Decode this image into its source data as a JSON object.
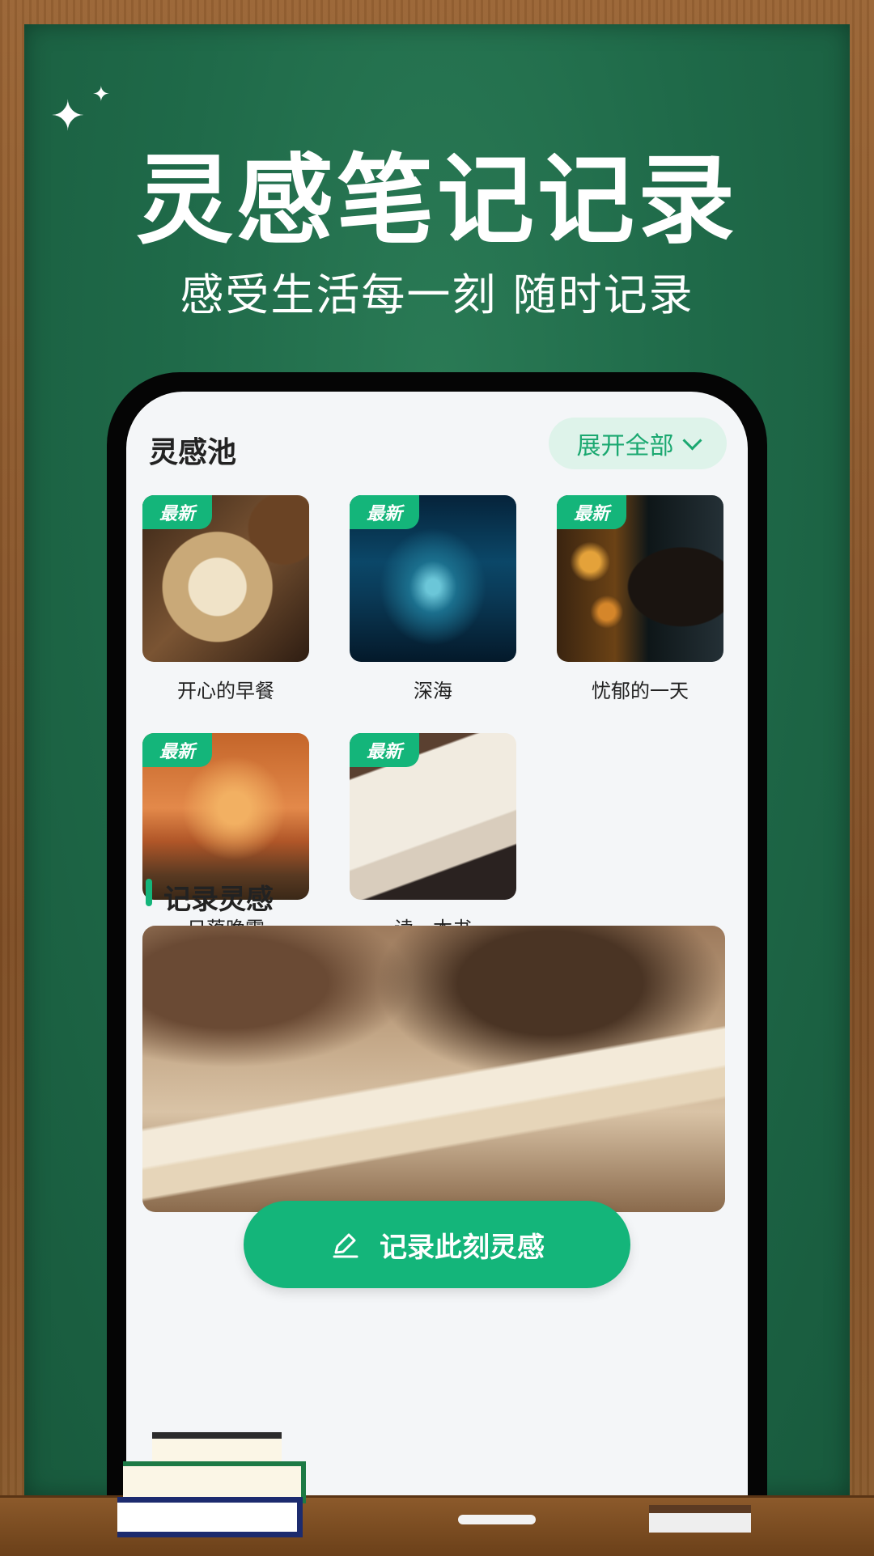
{
  "headline": "灵感笔记记录",
  "subheadline": "感受生活每一刻 随时记录",
  "pool": {
    "title": "灵感池",
    "expand_label": "展开全部",
    "badge": "最新",
    "items": [
      {
        "label": "开心的早餐"
      },
      {
        "label": "深海"
      },
      {
        "label": "忧郁的一天"
      },
      {
        "label": "日落晚霞"
      },
      {
        "label": "读一本书"
      }
    ]
  },
  "record": {
    "title": "记录灵感",
    "button_label": "记录此刻灵感"
  },
  "colors": {
    "accent": "#14b57a",
    "board": "#1f6a49",
    "wood": "#8a5a2c"
  },
  "icons": [
    "sparkle-icon",
    "chevron-down-icon",
    "edit-pen-icon"
  ]
}
